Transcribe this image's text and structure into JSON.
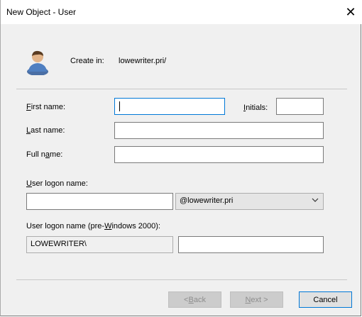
{
  "window": {
    "title": "New Object - User",
    "close_glyph": "✕"
  },
  "create_in": {
    "label": "Create in:",
    "value": "lowewriter.pri/"
  },
  "form": {
    "first_name": {
      "label_u": "F",
      "label_rest": "irst name:",
      "value": ""
    },
    "initials": {
      "label_u": "I",
      "label_rest": "nitials:",
      "value": ""
    },
    "last_name": {
      "label_u": "L",
      "label_rest": "ast name:",
      "value": ""
    },
    "full_name": {
      "label_pre": "Full n",
      "label_u": "a",
      "label_rest": "me:",
      "value": ""
    },
    "logon": {
      "label_u": "U",
      "label_rest": "ser logon name:",
      "value": "",
      "domain": "@lowewriter.pri"
    },
    "pre2000": {
      "label_pre": "User logon name (pre-",
      "label_u": "W",
      "label_rest": "indows 2000):",
      "prefix": "LOWEWRITER\\",
      "value": ""
    }
  },
  "buttons": {
    "back": {
      "pre": "< ",
      "u": "B",
      "rest": "ack"
    },
    "next": {
      "u": "N",
      "rest": "ext >"
    },
    "cancel": "Cancel"
  },
  "icons": {
    "user": "user-icon",
    "chevron": "chevron-down-icon"
  }
}
